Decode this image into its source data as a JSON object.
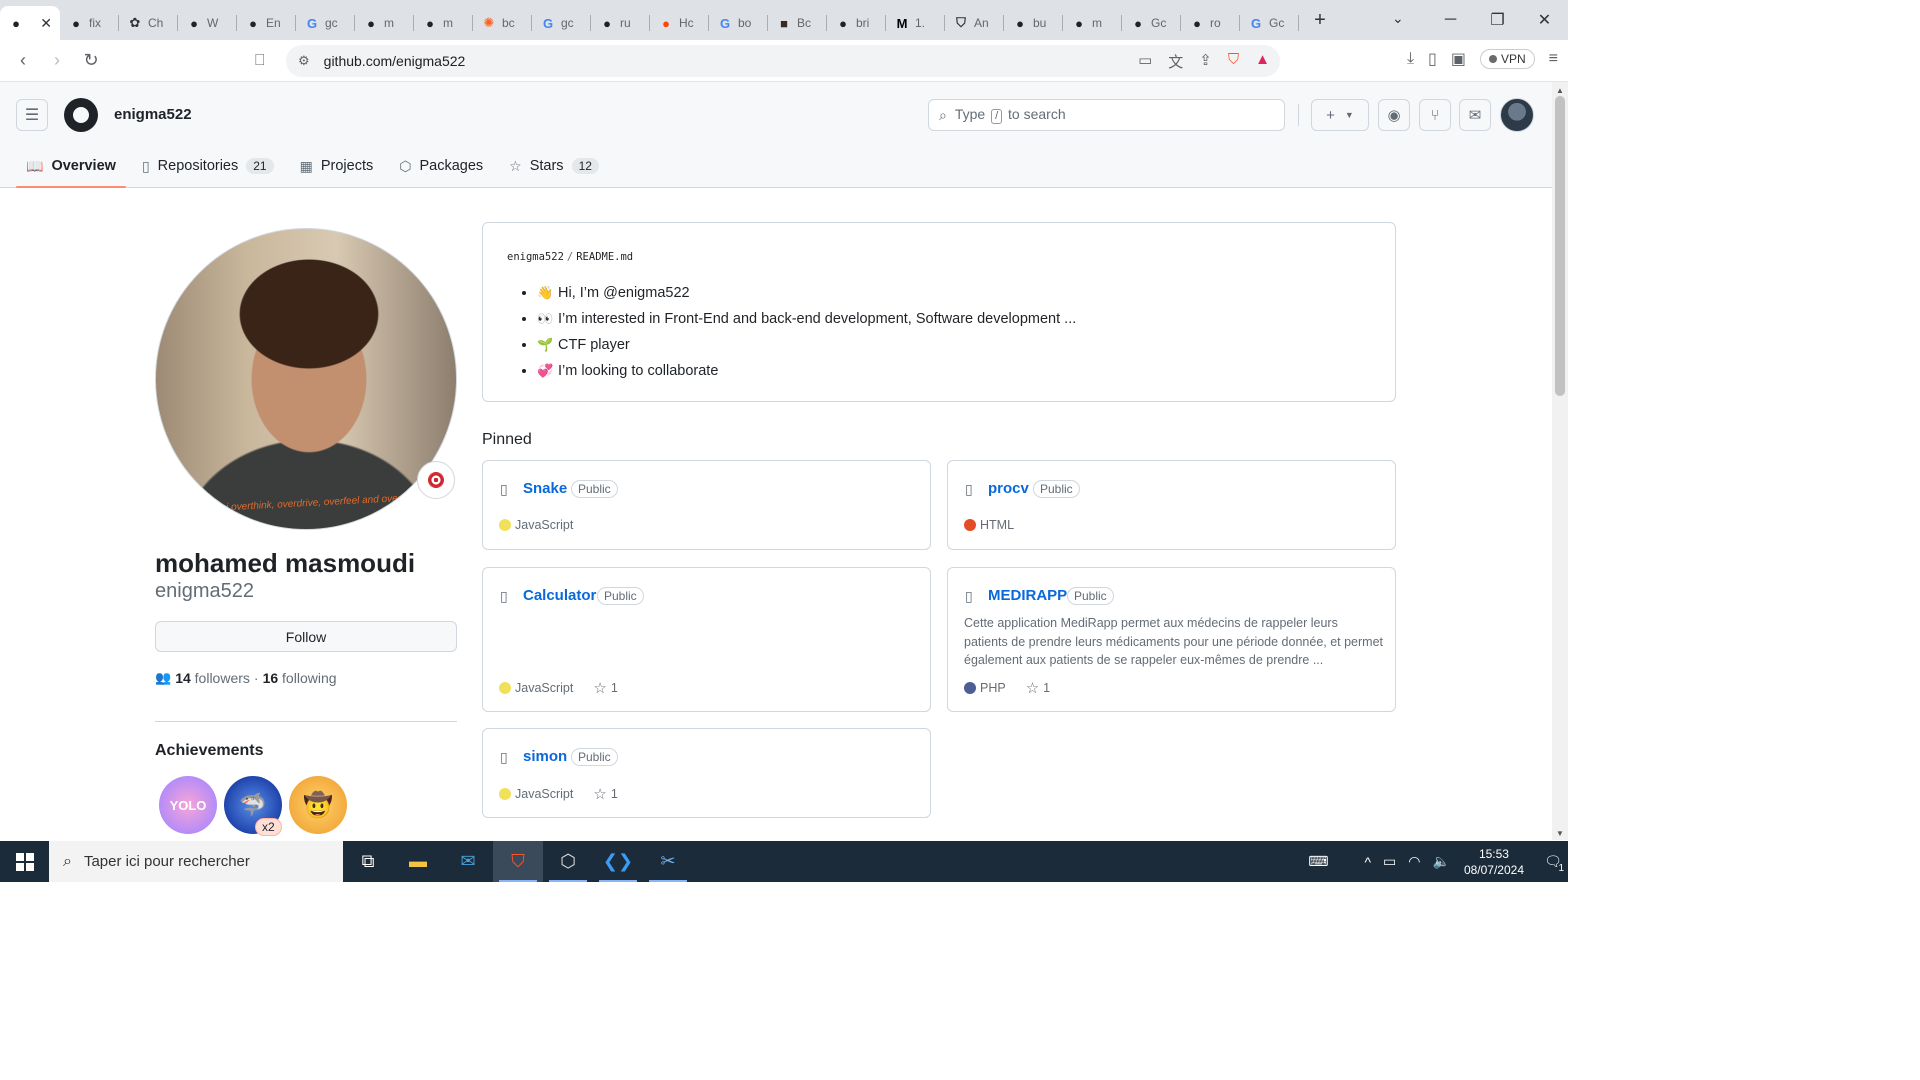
{
  "browser": {
    "tabs": [
      {
        "label": "",
        "favicon": "github-icon",
        "active": true
      },
      {
        "label": "fix",
        "favicon": "github-icon"
      },
      {
        "label": "Ch",
        "favicon": "openai-icon"
      },
      {
        "label": "W",
        "favicon": "github-icon"
      },
      {
        "label": "En",
        "favicon": "github-icon"
      },
      {
        "label": "gc",
        "favicon": "google-icon"
      },
      {
        "label": "m",
        "favicon": "github-icon"
      },
      {
        "label": "m",
        "favicon": "github-icon"
      },
      {
        "label": "bc",
        "favicon": "orange-gear-icon"
      },
      {
        "label": "gc",
        "favicon": "google-icon"
      },
      {
        "label": "ru",
        "favicon": "github-icon"
      },
      {
        "label": "Hc",
        "favicon": "reddit-icon"
      },
      {
        "label": "bo",
        "favicon": "google-icon"
      },
      {
        "label": "Bc",
        "favicon": "person-icon"
      },
      {
        "label": "bri",
        "favicon": "github-icon"
      },
      {
        "label": "1.",
        "favicon": "medium-icon"
      },
      {
        "label": "An",
        "favicon": "shield-icon"
      },
      {
        "label": "bu",
        "favicon": "github-icon"
      },
      {
        "label": "m",
        "favicon": "github-icon"
      },
      {
        "label": "Gc",
        "favicon": "github-icon"
      },
      {
        "label": "ro",
        "favicon": "github-icon"
      },
      {
        "label": "Gc",
        "favicon": "google-icon"
      }
    ],
    "url": "github.com/enigma522",
    "vpn_label": "VPN"
  },
  "github": {
    "username": "enigma522",
    "search_placeholder_prefix": "Type",
    "search_key": "/",
    "search_placeholder_suffix": "to search",
    "nav": {
      "overview": "Overview",
      "repositories": "Repositories",
      "repositories_count": "21",
      "projects": "Projects",
      "packages": "Packages",
      "stars": "Stars",
      "stars_count": "12"
    }
  },
  "profile": {
    "full_name": "mohamed masmoudi",
    "login": "enigma522",
    "shirt_text": "i overthink, overdrive, overfeel and overstress",
    "follow_label": "Follow",
    "followers_count": "14",
    "followers_label": "followers",
    "separator": "·",
    "following_count": "16",
    "following_label": "following",
    "achievements_title": "Achievements",
    "achievement_multiplier": "x2",
    "achievement_yolo_text": "YOLO"
  },
  "readme": {
    "owner": "enigma522",
    "file": "README.md",
    "items": [
      {
        "emoji": "👋",
        "text": "Hi, I’m @enigma522"
      },
      {
        "emoji": "👀",
        "text": "I’m interested in Front-End and back-end development, Software development ..."
      },
      {
        "emoji": "🌱",
        "text": "CTF player"
      },
      {
        "emoji": "💞",
        "text": "I’m looking to collaborate"
      }
    ]
  },
  "pinned": {
    "title": "Pinned",
    "repos": [
      {
        "name": "Snake",
        "visibility": "Public",
        "language": "JavaScript",
        "lang_color": "#f1e05a",
        "stars": ""
      },
      {
        "name": "procv",
        "visibility": "Public",
        "language": "HTML",
        "lang_color": "#e34c26",
        "stars": ""
      },
      {
        "name": "Calculator",
        "visibility": "Public",
        "language": "JavaScript",
        "lang_color": "#f1e05a",
        "stars": "1"
      },
      {
        "name": "MEDIRAPP",
        "visibility": "Public",
        "description": "Cette application MediRapp permet aux médecins de rappeler leurs patients de prendre leurs médicaments pour une période donnée, et permet également aux patients de se rappeler eux-mêmes de prendre ...",
        "language": "PHP",
        "lang_color": "#4F5D95",
        "stars": "1"
      },
      {
        "name": "simon",
        "visibility": "Public",
        "language": "JavaScript",
        "lang_color": "#f1e05a",
        "stars": "1"
      }
    ]
  },
  "taskbar": {
    "search_placeholder": "Taper ici pour rechercher",
    "time": "15:53",
    "date": "08/07/2024",
    "notification_count": "1"
  }
}
